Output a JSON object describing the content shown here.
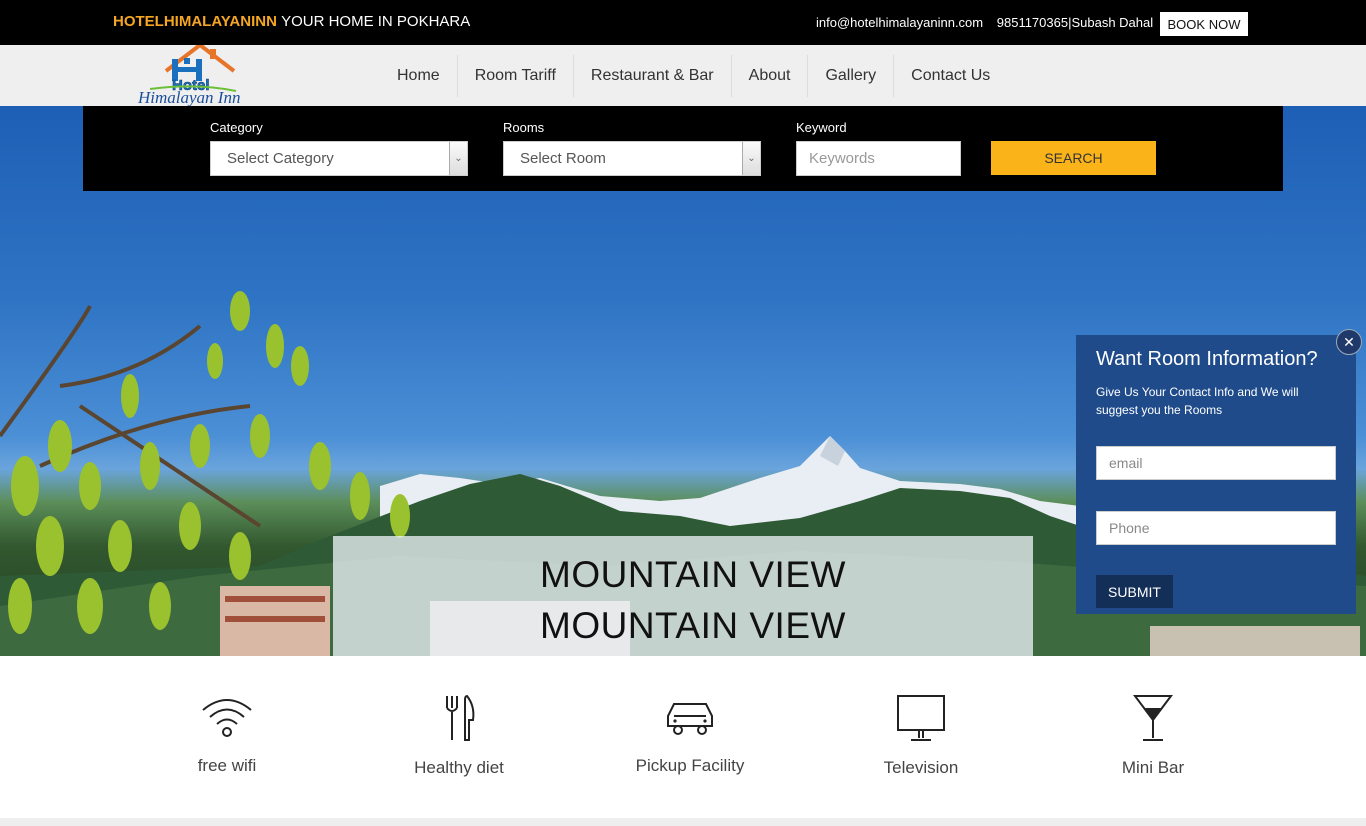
{
  "topbar": {
    "brand_accent": "HOTELHIMALAYANINN",
    "brand_tagline": "YOUR HOME IN POKHARA",
    "email": "info@hotelhimalayaninn.com",
    "phone_contact": "9851170365|Subash Dahal",
    "book_now": "BOOK NOW"
  },
  "logo": {
    "line1": "Hotel",
    "line2": "Himalayan Inn"
  },
  "nav": {
    "items": [
      "Home",
      "Room Tariff",
      "Restaurant & Bar",
      "About",
      "Gallery",
      "Contact Us"
    ]
  },
  "search": {
    "category_label": "Category",
    "category_value": "Select Category",
    "rooms_label": "Rooms",
    "rooms_value": "Select Room",
    "keyword_label": "Keyword",
    "keyword_placeholder": "Keywords",
    "button": "SEARCH"
  },
  "hero": {
    "caption_line1": "MOUNTAIN VIEW",
    "caption_line2": "MOUNTAIN VIEW"
  },
  "popup": {
    "title": "Want Room Information?",
    "description": "Give Us Your Contact Info and We will suggest you the Rooms",
    "email_placeholder": "email",
    "phone_placeholder": "Phone",
    "submit": "SUBMIT"
  },
  "features": [
    {
      "label": "free wifi",
      "icon": "wifi-icon"
    },
    {
      "label": "Healthy diet",
      "icon": "fork-knife-icon"
    },
    {
      "label": "Pickup Facility",
      "icon": "car-icon"
    },
    {
      "label": "Television",
      "icon": "television-icon"
    },
    {
      "label": "Mini Bar",
      "icon": "cocktail-glass-icon"
    }
  ],
  "colors": {
    "accent": "#f5a623",
    "search_button": "#fbb31a",
    "popup_bg": "#1f4b8a"
  }
}
